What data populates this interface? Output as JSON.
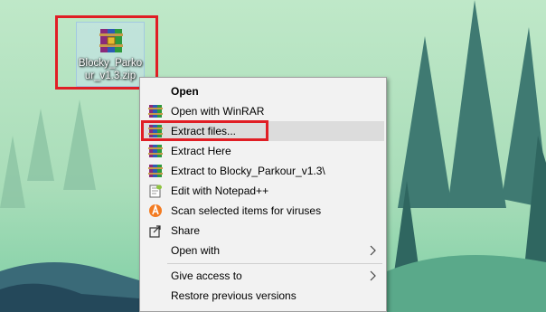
{
  "desktop": {
    "file": {
      "name": "Blocky_Parkour_v1.3.zip",
      "icon": "winrar-archive-icon"
    }
  },
  "context_menu": {
    "items": [
      {
        "label": "Open",
        "icon": "",
        "bold": true
      },
      {
        "label": "Open with WinRAR",
        "icon": "winrar-icon"
      },
      {
        "label": "Extract files...",
        "icon": "winrar-icon",
        "highlighted": true
      },
      {
        "label": "Extract Here",
        "icon": "winrar-icon"
      },
      {
        "label": "Extract to Blocky_Parkour_v1.3\\",
        "icon": "winrar-icon"
      },
      {
        "label": "Edit with Notepad++",
        "icon": "notepad-plus-plus-icon"
      },
      {
        "label": "Scan selected items for viruses",
        "icon": "avast-icon"
      },
      {
        "label": "Share",
        "icon": "share-icon"
      },
      {
        "label": "Open with",
        "icon": "",
        "submenu": true
      },
      {
        "label": "Give access to",
        "icon": "",
        "submenu": true
      },
      {
        "label": "Restore previous versions",
        "icon": ""
      }
    ]
  },
  "colors": {
    "highlight_border": "#e01e25",
    "menu_bg": "#f2f2f2",
    "hover_bg": "#dcdcdc"
  }
}
